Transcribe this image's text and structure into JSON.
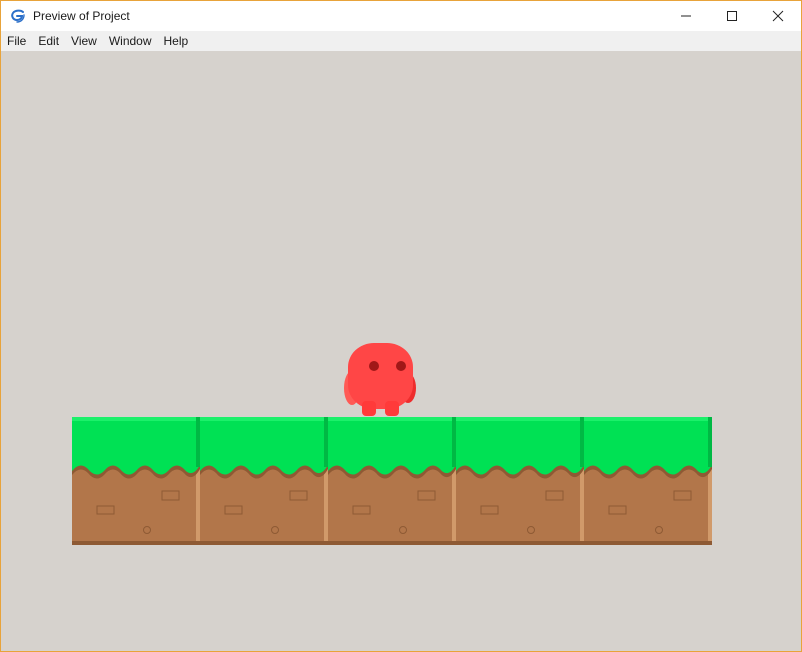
{
  "window": {
    "title": "Preview of Project",
    "icon": "gdevelop-logo-icon",
    "border_color": "#e8a33a",
    "controls": [
      "minimize-icon",
      "maximize-icon",
      "close-icon"
    ]
  },
  "menu": {
    "items": [
      {
        "label": "File"
      },
      {
        "label": "Edit"
      },
      {
        "label": "View"
      },
      {
        "label": "Window"
      },
      {
        "label": "Help"
      }
    ]
  },
  "scene": {
    "background_color": "#d6d2cd",
    "ground_tile_count": 5,
    "player": {
      "color": "#ff4444",
      "eye_color": "#a01818"
    },
    "grass_color": "#00e154",
    "dirt_color": "#b2764a"
  }
}
